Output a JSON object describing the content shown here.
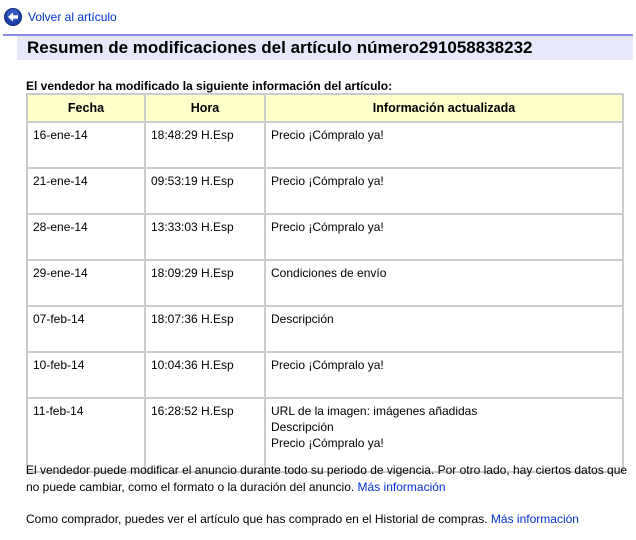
{
  "back_link": {
    "label": "Volver al artículo",
    "icon": "back-arrow-icon"
  },
  "title": "Resumen de modificaciones del artículo número291058838232",
  "intro": "El vendedor ha modificado la siguiente información del artículo:",
  "table": {
    "headers": [
      "Fecha",
      "Hora",
      "Información actualizada"
    ],
    "rows": [
      {
        "fecha": "16-ene-14",
        "hora": "18:48:29 H.Esp",
        "info": [
          "Precio ¡Cómpralo ya!"
        ]
      },
      {
        "fecha": "21-ene-14",
        "hora": "09:53:19 H.Esp",
        "info": [
          "Precio ¡Cómpralo ya!"
        ]
      },
      {
        "fecha": "28-ene-14",
        "hora": "13:33:03 H.Esp",
        "info": [
          "Precio ¡Cómpralo ya!"
        ]
      },
      {
        "fecha": "29-ene-14",
        "hora": "18:09:29 H.Esp",
        "info": [
          "Condiciones de envío"
        ]
      },
      {
        "fecha": "07-feb-14",
        "hora": "18:07:36 H.Esp",
        "info": [
          "Descripción"
        ]
      },
      {
        "fecha": "10-feb-14",
        "hora": "10:04:36 H.Esp",
        "info": [
          "Precio ¡Cómpralo ya!"
        ]
      },
      {
        "fecha": "11-feb-14",
        "hora": "16:28:52 H.Esp",
        "info": [
          "URL de la imagen: imágenes añadidas",
          "Descripción",
          "Precio ¡Cómpralo ya!"
        ]
      }
    ]
  },
  "footer": {
    "para1_text": "El vendedor puede modificar el anuncio durante todo su periodo de vigencia. Por otro lado, hay ciertos datos que no puede cambiar, como el formato o la duración del anuncio.",
    "para1_link": "Más información",
    "para2_text": "Como comprador, puedes ver el artículo que has comprado en el Historial de compras.",
    "para2_link": "Más información"
  },
  "colors": {
    "link": "#0033cc",
    "title_bar_bg": "#e7e9fb",
    "title_bar_border": "#8a8ee0",
    "header_bg": "#ffffcc",
    "cell_border": "#cccccc"
  }
}
